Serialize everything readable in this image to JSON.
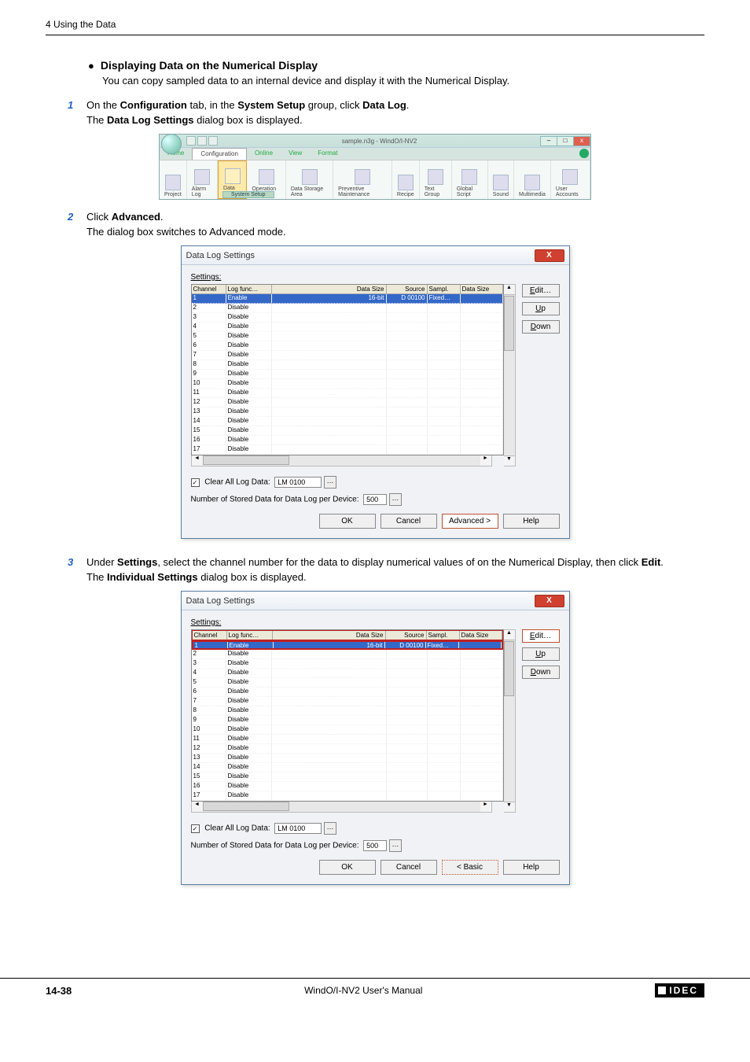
{
  "header": {
    "section": "4 Using the Data"
  },
  "bullet": {
    "title": "Displaying Data on the Numerical Display",
    "desc": "You can copy sampled data to an internal device and display it with the Numerical Display."
  },
  "steps": {
    "s1": {
      "num": "1",
      "text_a": "On the ",
      "b1": "Configuration",
      "text_b": " tab, in the ",
      "b2": "System Setup",
      "text_c": " group, click ",
      "b3": "Data Log",
      "text_d": ".",
      "sub_a": "The ",
      "sub_b": "Data Log Settings",
      "sub_c": " dialog box is displayed."
    },
    "s2": {
      "num": "2",
      "text_a": "Click ",
      "b1": "Advanced",
      "text_b": ".",
      "sub": "The dialog box switches to Advanced mode."
    },
    "s3": {
      "num": "3",
      "text_a": "Under ",
      "b1": "Settings",
      "text_b": ", select the channel number for the data to display numerical values of on the Numerical Display, then click ",
      "b2": "Edit",
      "text_c": ".",
      "sub_a": "The ",
      "sub_b": "Individual Settings",
      "sub_c": " dialog box is displayed."
    }
  },
  "ribbon": {
    "sample_name": "sample.n3g - WindO/I-NV2",
    "tabs": {
      "home": "Home",
      "config": "Configuration",
      "online": "Online",
      "view": "View",
      "format": "Format"
    },
    "items": {
      "project": "Project",
      "alarm": "Alarm Log",
      "data": "Data Log",
      "operation": "Operation Log",
      "dstorage": "Data Storage Area",
      "preventive": "Preventive Maintenance",
      "recipe": "Recipe",
      "textgroup": "Text Group",
      "global": "Global Script",
      "sound": "Sound",
      "multimedia": "Multimedia",
      "user": "User Accounts"
    },
    "group_label": "System Setup"
  },
  "dialog": {
    "title": "Data Log Settings",
    "settings_label": "Settings:",
    "headers": {
      "channel": "Channel",
      "logfunc": "Log func…",
      "datasize": "Data Size",
      "source": "Source",
      "sampl": "Sampl.",
      "datasize2": "Data Size"
    },
    "row1": {
      "ch": "1",
      "log": "Enable",
      "size": "16-bit",
      "src": "D 00100",
      "samp": "Fixed…"
    },
    "disable": "Disable",
    "channels": [
      "2",
      "3",
      "4",
      "5",
      "6",
      "7",
      "8",
      "9",
      "10",
      "11",
      "12",
      "13",
      "14",
      "15",
      "16",
      "17"
    ],
    "side": {
      "edit": "Edit…",
      "up": "Up",
      "down": "Down"
    },
    "clear_label": "Clear All Log Data:",
    "clear_val": "LM 0100",
    "num_stored_label": "Number of Stored Data for Data Log per Device:",
    "num_stored_val": "500",
    "buttons": {
      "ok": "OK",
      "cancel": "Cancel",
      "advanced": "Advanced >",
      "basic": "< Basic",
      "help": "Help"
    }
  },
  "footer": {
    "page": "14-38",
    "manual": "WindO/I-NV2 User's Manual",
    "brand": "IDEC"
  }
}
